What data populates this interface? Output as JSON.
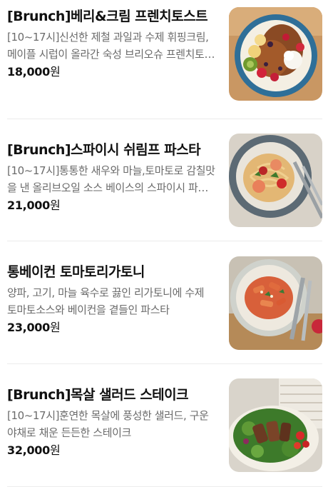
{
  "menu": {
    "items": [
      {
        "name": "[Brunch]베리&크림 프렌치토스트",
        "description": "[10~17시]신선한 제철 과일과 수제 휘핑크림, 메이플 시럽이 올라간 숙성 브리오슈 프렌치토스트",
        "price": "18,000",
        "currency": "원",
        "image": "french-toast-photo"
      },
      {
        "name": "[Brunch]스파이시 쉬림프 파스타",
        "description": "[10~17시]통통한 새우와 마늘,토마토로 감칠맛을 낸 올리브오일 소스 베이스의 스파이시 파스타",
        "price": "21,000",
        "currency": "원",
        "image": "shrimp-pasta-photo"
      },
      {
        "name": "통베이컨 토마토리가토니",
        "description": "양파, 고기, 마늘 육수로 끓인 리가토니에 수제 토마토소스와 베이컨을 곁들인 파스타",
        "price": "23,000",
        "currency": "원",
        "image": "rigatoni-photo"
      },
      {
        "name": "[Brunch]목살 샐러드 스테이크",
        "description": "[10~17시]훈연한 목살에 풍성한 샐러드, 구운야채로 채운 든든한 스테이크",
        "price": "32,000",
        "currency": "원",
        "image": "steak-salad-photo"
      }
    ]
  }
}
